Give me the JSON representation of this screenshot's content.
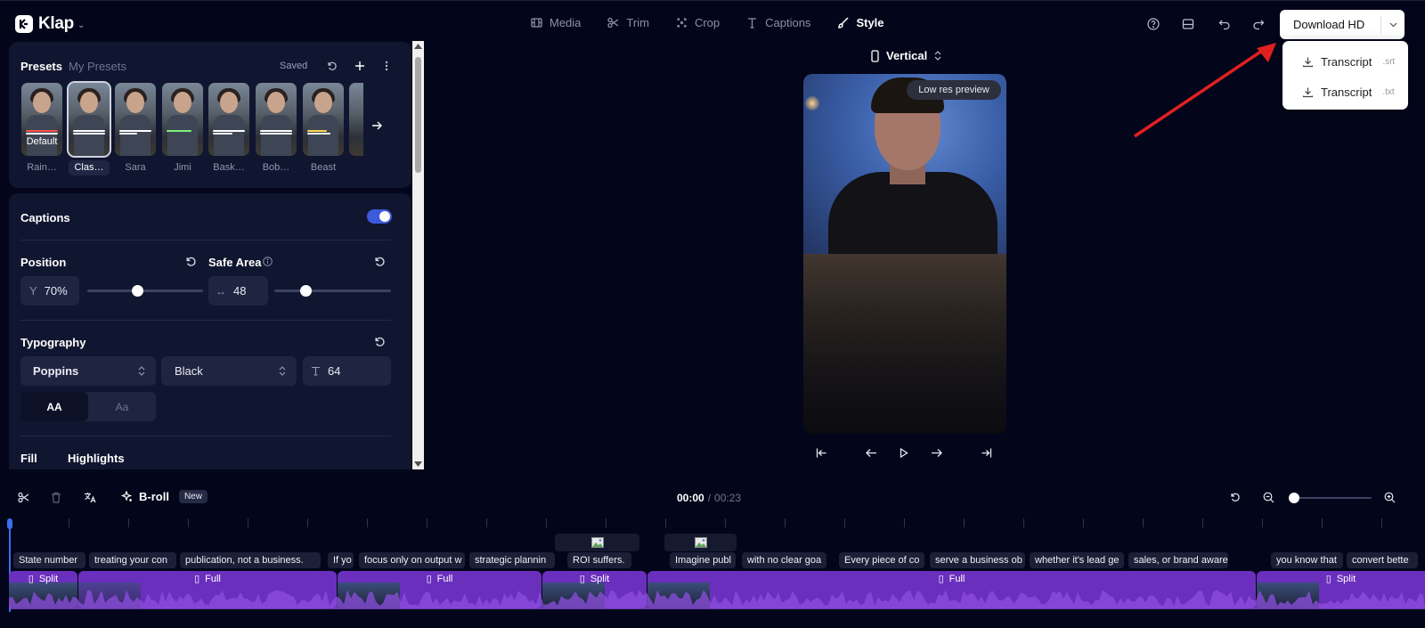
{
  "app": {
    "name": "Klap"
  },
  "nav": {
    "items": [
      "Media",
      "Trim",
      "Crop",
      "Captions",
      "Style"
    ],
    "active": "Style"
  },
  "download": {
    "label": "Download HD",
    "menu": [
      {
        "label": "Transcript",
        "ext": ".srt"
      },
      {
        "label": "Transcript",
        "ext": ".txt"
      }
    ]
  },
  "presets": {
    "tab_active": "Presets",
    "tab_other": "My Presets",
    "saved": "Saved",
    "default_badge": "Default",
    "items": [
      "Rain…",
      "Clas…",
      "Sara",
      "Jimi",
      "Bask…",
      "Bob…",
      "Beast"
    ]
  },
  "captions": {
    "title": "Captions",
    "enabled": true
  },
  "position": {
    "title": "Position",
    "y_prefix": "Y",
    "y_value": "70%",
    "y_level": 0.7
  },
  "safe_area": {
    "title": "Safe Area",
    "value": "48",
    "level": 0.22
  },
  "typography": {
    "title": "Typography",
    "font": "Poppins",
    "weight": "Black",
    "size": "64",
    "case_upper": "AA",
    "case_title": "Aa"
  },
  "fill": {
    "tab1": "Fill",
    "tab2": "Highlights"
  },
  "preview": {
    "orientation": "Vertical",
    "badge": "Low res preview"
  },
  "timeline": {
    "broll": "B-roll",
    "new_badge": "New",
    "current_time": "00:00",
    "separator": "/",
    "total_time": "00:23",
    "captions": [
      "State number",
      "treating your con",
      "publication, not a business.",
      "If yo",
      "focus only on output w",
      "strategic plannin",
      "ROI suffers.",
      "Imagine publ",
      "with no clear goa",
      "Every piece of co",
      "serve a business ob",
      "whether it's lead ge",
      "sales, or brand aware",
      "you know that",
      "convert bette"
    ],
    "clips": [
      "Split",
      "Full",
      "Full",
      "Split",
      "Full",
      "Split"
    ]
  },
  "colors": {
    "accent": "#3b5bdb",
    "clip": "#6a2fbd",
    "background": "#03061a",
    "panel": "#111630"
  }
}
